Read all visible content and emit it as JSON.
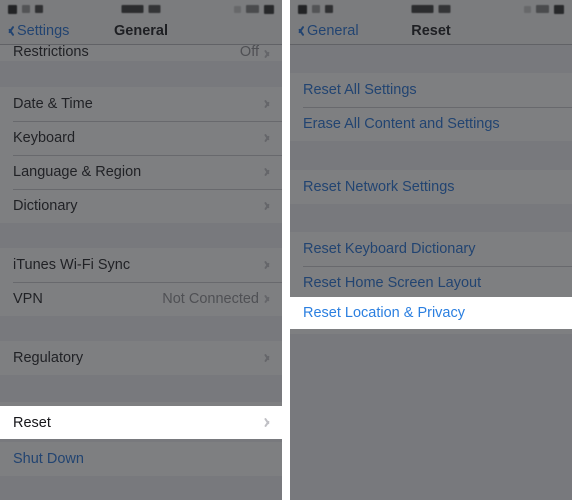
{
  "meta": {
    "accent_blue": "#1a6bd6",
    "spotlight_blue": "#2b7fe0",
    "dim_overlay": "rgba(40,41,45,0.60)",
    "row_bg": "#ffffff",
    "group_gap_bg": "#efeff4",
    "separator": "#c8c7cc",
    "value_gray": "#8a8a8f"
  },
  "left_phone": {
    "nav": {
      "back_label": "Settings",
      "title": "General"
    },
    "rows": [
      {
        "label": "Restrictions",
        "value": "Off",
        "chevron": true,
        "clipped": true,
        "type": "plain"
      }
    ],
    "group2": [
      {
        "label": "Date & Time",
        "value": "",
        "chevron": true,
        "type": "plain"
      },
      {
        "label": "Keyboard",
        "value": "",
        "chevron": true,
        "type": "plain"
      },
      {
        "label": "Language & Region",
        "value": "",
        "chevron": true,
        "type": "plain"
      },
      {
        "label": "Dictionary",
        "value": "",
        "chevron": true,
        "type": "plain"
      }
    ],
    "group3": [
      {
        "label": "iTunes Wi-Fi Sync",
        "value": "",
        "chevron": true,
        "type": "plain"
      },
      {
        "label": "VPN",
        "value": "Not Connected",
        "chevron": true,
        "type": "plain"
      }
    ],
    "group4": [
      {
        "label": "Regulatory",
        "value": "",
        "chevron": true,
        "type": "plain"
      }
    ],
    "group5": [
      {
        "label": "Reset",
        "value": "",
        "chevron": true,
        "type": "plain",
        "spotlight": true
      }
    ],
    "group6": [
      {
        "label": "Shut Down",
        "value": "",
        "chevron": false,
        "type": "link"
      }
    ],
    "spotlight_row": {
      "label": "Reset",
      "chevron": true
    }
  },
  "right_phone": {
    "nav": {
      "back_label": "General",
      "title": "Reset"
    },
    "group1": [
      {
        "label": "Reset All Settings",
        "type": "link"
      },
      {
        "label": "Erase All Content and Settings",
        "type": "link"
      }
    ],
    "group2": [
      {
        "label": "Reset Network Settings",
        "type": "link"
      }
    ],
    "group3": [
      {
        "label": "Reset Keyboard Dictionary",
        "type": "link"
      },
      {
        "label": "Reset Home Screen Layout",
        "type": "link"
      },
      {
        "label": "Reset Location & Privacy",
        "type": "link",
        "spotlight": true
      }
    ],
    "spotlight_row": {
      "label": "Reset Location & Privacy"
    }
  }
}
